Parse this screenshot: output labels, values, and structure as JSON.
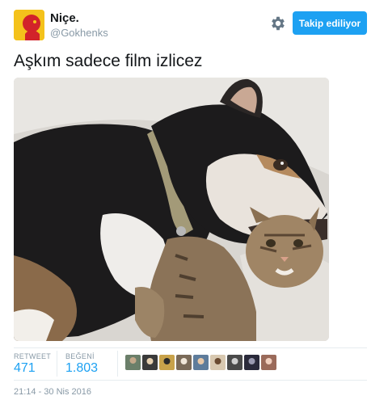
{
  "user": {
    "name": "Niçe.",
    "handle": "@Gokhenks",
    "avatar_color": "#f4c21b"
  },
  "actions": {
    "settings_icon": "gear-icon",
    "follow_label": "Takip ediliyor"
  },
  "tweet": {
    "text": "Aşkım sadece film izlicez",
    "media_description_icon": "photo"
  },
  "stats": {
    "retweet_label": "RETWEET",
    "retweet_count": "471",
    "like_label": "BEĞENİ",
    "like_count": "1.803"
  },
  "likers": [
    {
      "color": "#6b7f6a"
    },
    {
      "color": "#3a3a3a"
    },
    {
      "color": "#c8a24a"
    },
    {
      "color": "#7a6a58"
    },
    {
      "color": "#5e7c9b"
    },
    {
      "color": "#d8c8b0"
    },
    {
      "color": "#4a4a4a"
    },
    {
      "color": "#2a2a3a"
    },
    {
      "color": "#9a6a5a"
    }
  ],
  "timestamp": "21:14 - 30 Nis 2016",
  "colors": {
    "accent": "#1da1f2",
    "muted": "#8899a6",
    "text": "#14171a"
  }
}
